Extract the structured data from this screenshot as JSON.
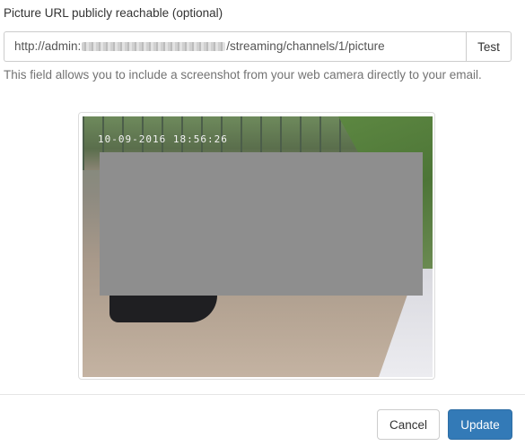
{
  "picture_url_field": {
    "label": "Picture URL publicly reachable (optional)",
    "value_prefix": "http://admin:",
    "value_suffix": "/streaming/channels/1/picture",
    "test_button_label": "Test",
    "help_text": "This field allows you to include a screenshot from your web camera directly to your email."
  },
  "camera_preview": {
    "timestamp_overlay": "10-09-2016 18:56:26"
  },
  "footer": {
    "cancel_label": "Cancel",
    "update_label": "Update"
  },
  "colors": {
    "primary": "#337ab7",
    "border": "#cccccc",
    "help_text": "#737373"
  }
}
